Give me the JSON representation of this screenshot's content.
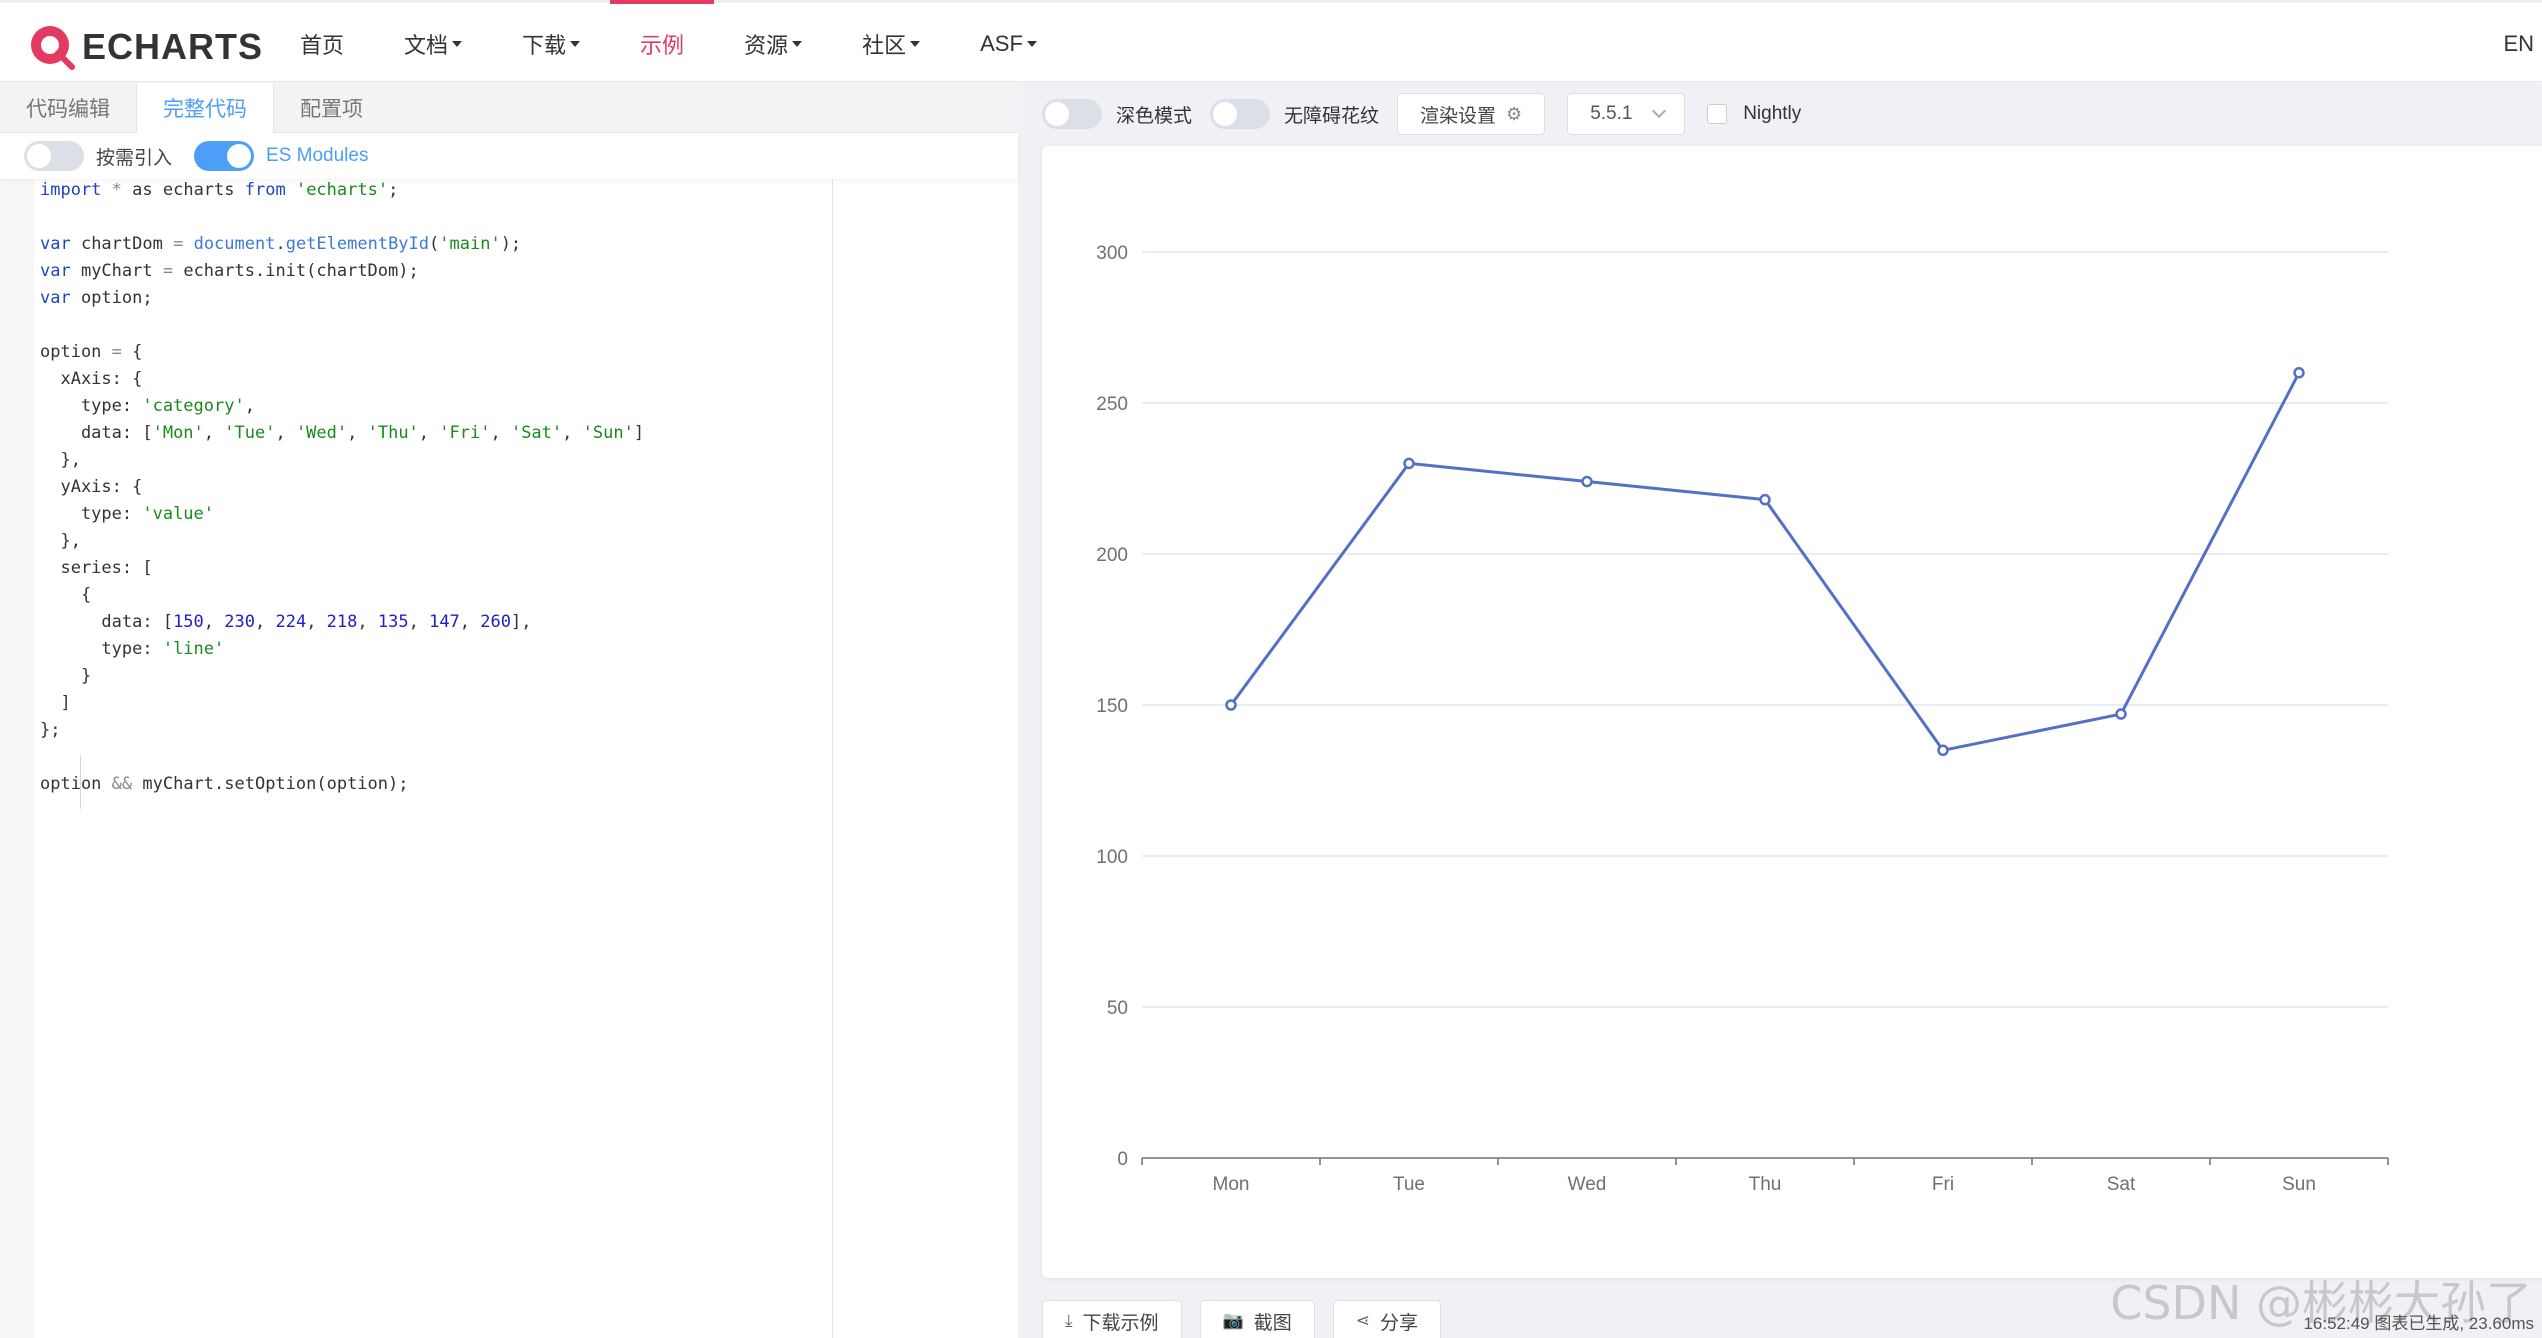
{
  "brand": {
    "name": "ECHARTS",
    "accent": "#e43961"
  },
  "nav": {
    "items": [
      {
        "label": "首页",
        "dropdown": false,
        "active": false
      },
      {
        "label": "文档",
        "dropdown": true,
        "active": false
      },
      {
        "label": "下载",
        "dropdown": true,
        "active": false
      },
      {
        "label": "示例",
        "dropdown": false,
        "active": true
      },
      {
        "label": "资源",
        "dropdown": true,
        "active": false
      },
      {
        "label": "社区",
        "dropdown": true,
        "active": false
      },
      {
        "label": "ASF",
        "dropdown": true,
        "active": false
      }
    ],
    "lang": "EN"
  },
  "editor": {
    "tabs": [
      {
        "label": "代码编辑",
        "active": false
      },
      {
        "label": "完整代码",
        "active": true
      },
      {
        "label": "配置项",
        "active": false
      }
    ],
    "toggles": [
      {
        "label": "按需引入",
        "on": false
      },
      {
        "label": "ES Modules",
        "on": true
      }
    ]
  },
  "preview": {
    "dark_mode_label": "深色模式",
    "aria_label": "无障碍花纹",
    "render_settings_label": "渲染设置",
    "version": "5.5.1",
    "nightly_label": "Nightly",
    "buttons": {
      "download": "下载示例",
      "screenshot": "截图",
      "share": "分享"
    },
    "status": "16:52:49  图表已生成, 23.60ms",
    "watermark": "CSDN @彬彬大孙了"
  },
  "chart_data": {
    "type": "line",
    "categories": [
      "Mon",
      "Tue",
      "Wed",
      "Thu",
      "Fri",
      "Sat",
      "Sun"
    ],
    "values": [
      150,
      230,
      224,
      218,
      135,
      147,
      260
    ],
    "ylim": [
      0,
      300
    ],
    "yticks": [
      0,
      50,
      100,
      150,
      200,
      250,
      300
    ],
    "grid": true,
    "line_color": "#5470c6"
  }
}
